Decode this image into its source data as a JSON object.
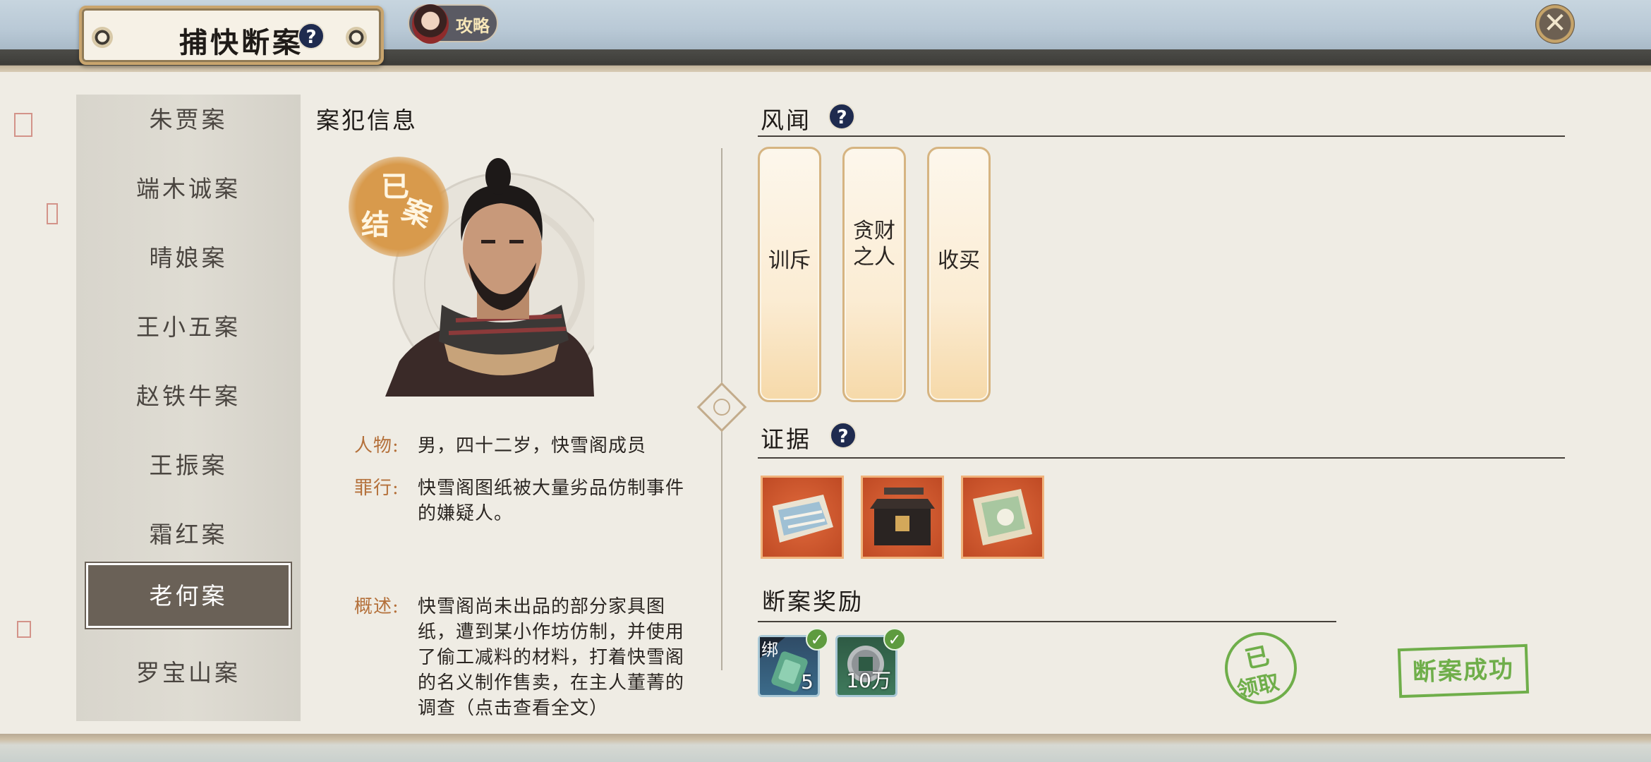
{
  "header": {
    "title": "捕快断案",
    "help_icon": "question-icon",
    "guide_label": "攻略",
    "close_icon": "close-icon"
  },
  "case_list": {
    "items": [
      {
        "label": "朱贾案",
        "selected": false
      },
      {
        "label": "端木诚案",
        "selected": false
      },
      {
        "label": "晴娘案",
        "selected": false
      },
      {
        "label": "王小五案",
        "selected": false
      },
      {
        "label": "赵铁牛案",
        "selected": false
      },
      {
        "label": "王振案",
        "selected": false
      },
      {
        "label": "霜红案",
        "selected": false
      },
      {
        "label": "老何案",
        "selected": true
      },
      {
        "label": "罗宝山案",
        "selected": false
      }
    ]
  },
  "criminal": {
    "section_title": "案犯信息",
    "closed_stamp": [
      "已",
      "结",
      "案"
    ],
    "person_label": "人物:",
    "person_text": "男，四十二岁，快雪阁成员",
    "crime_label": "罪行:",
    "crime_text": "快雪阁图纸被大量劣品仿制事件的嫌疑人。",
    "summary_label": "概述:",
    "summary_text": "快雪阁尚未出品的部分家具图纸，遭到某小作坊仿制，并使用了偷工减料的材料，打着快雪阁的名义制作售卖，在主人董菁的调查（点击查看全文）"
  },
  "rumors": {
    "section_title": "风闻",
    "cards": [
      {
        "text": "训斥"
      },
      {
        "text": "贪财之人"
      },
      {
        "text": "收买"
      }
    ]
  },
  "evidence": {
    "section_title": "证据",
    "items": [
      {
        "icon": "blueprint-map-icon"
      },
      {
        "icon": "lockbox-icon"
      },
      {
        "icon": "scroll-document-icon"
      }
    ]
  },
  "reward": {
    "section_title": "断案奖励",
    "items": [
      {
        "icon": "jade-token-icon",
        "tag": "绑",
        "count": "5",
        "claimed": true
      },
      {
        "icon": "coin-icon",
        "count": "10万",
        "claimed": true
      }
    ],
    "claimed_stamp": [
      "已",
      "领取"
    ],
    "success_stamp": "断案成功"
  },
  "colors": {
    "label_orange": "#b4703a",
    "selected_bg": "#6a6157",
    "stamp_green": "#6fae4a",
    "evidence_bg": "#d95a30"
  }
}
